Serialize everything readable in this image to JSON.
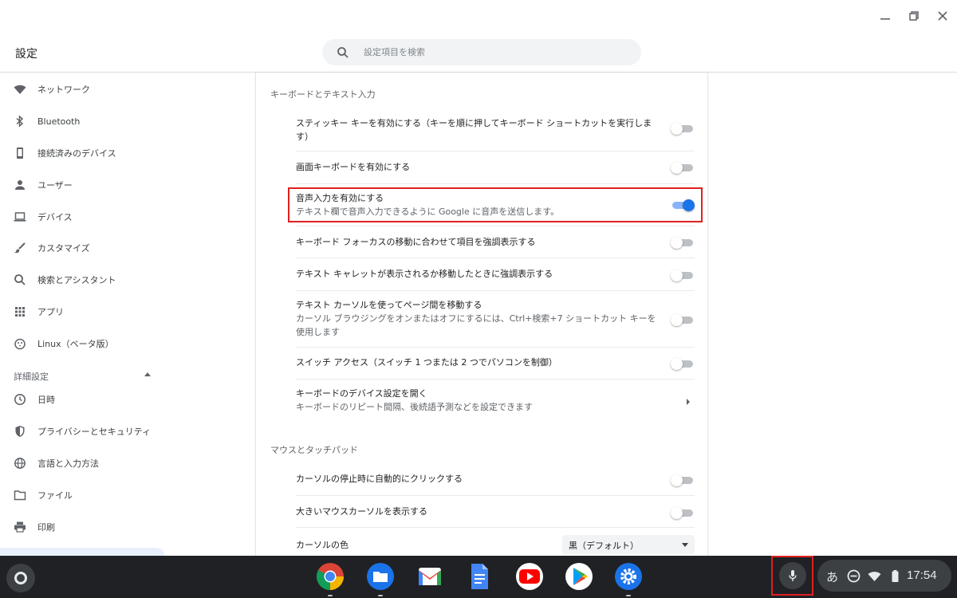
{
  "header": {
    "title": "設定",
    "search_placeholder": "設定項目を検索"
  },
  "sidebar": {
    "items": [
      {
        "label": "ネットワーク",
        "icon": "wifi-icon"
      },
      {
        "label": "Bluetooth",
        "icon": "bluetooth-icon"
      },
      {
        "label": "接続済みのデバイス",
        "icon": "phone-icon"
      },
      {
        "label": "ユーザー",
        "icon": "person-icon"
      },
      {
        "label": "デバイス",
        "icon": "laptop-icon"
      },
      {
        "label": "カスタマイズ",
        "icon": "brush-icon"
      },
      {
        "label": "検索とアシスタント",
        "icon": "search-icon"
      },
      {
        "label": "アプリ",
        "icon": "apps-grid-icon"
      },
      {
        "label": "Linux（ベータ版）",
        "icon": "penguin-icon"
      }
    ],
    "advanced_label": "詳細設定",
    "advanced_items": [
      {
        "label": "日時",
        "icon": "clock-icon"
      },
      {
        "label": "プライバシーとセキュリティ",
        "icon": "shield-icon"
      },
      {
        "label": "言語と入力方法",
        "icon": "globe-icon"
      },
      {
        "label": "ファイル",
        "icon": "folder-icon"
      },
      {
        "label": "印刷",
        "icon": "printer-icon"
      }
    ]
  },
  "main": {
    "keyboard_section": {
      "title": "キーボードとテキスト入力",
      "rows": [
        {
          "label": "スティッキー キーを有効にする（キーを順に押してキーボード ショートカットを実行します）",
          "toggle": false
        },
        {
          "label": "画面キーボードを有効にする",
          "toggle": false
        },
        {
          "label": "音声入力を有効にする",
          "sublabel": "テキスト欄で音声入力できるように Google に音声を送信します。",
          "toggle": true
        },
        {
          "label": "キーボード フォーカスの移動に合わせて項目を強調表示する",
          "toggle": false
        },
        {
          "label": "テキスト キャレットが表示されるか移動したときに強調表示する",
          "toggle": false
        },
        {
          "label": "テキスト カーソルを使ってページ間を移動する",
          "sublabel": "カーソル ブラウジングをオンまたはオフにするには、Ctrl+検索+7 ショートカット キーを使用します",
          "toggle": false
        },
        {
          "label": "スイッチ アクセス（スイッチ 1 つまたは 2 つでパソコンを制御）",
          "toggle": false
        },
        {
          "label": "キーボードのデバイス設定を開く",
          "sublabel": "キーボードのリピート間隔、後続語予測などを設定できます"
        }
      ]
    },
    "mouse_section": {
      "title": "マウスとタッチパッド",
      "rows": [
        {
          "label": "カーソルの停止時に自動的にクリックする",
          "toggle": false
        },
        {
          "label": "大きいマウスカーソルを表示する",
          "toggle": false
        },
        {
          "label": "カーソルの色",
          "select_value": "黒（デフォルト）"
        }
      ]
    }
  },
  "shelf": {
    "apps": [
      "chrome-icon",
      "files-icon",
      "gmail-icon",
      "docs-icon",
      "youtube-icon",
      "play-store-icon",
      "settings-icon"
    ],
    "tray": {
      "ime": "あ",
      "time": "17:54"
    }
  },
  "colors": {
    "accent": "#1a73e8",
    "highlight_box": "#e0201f",
    "shelf_bg": "#202124"
  }
}
